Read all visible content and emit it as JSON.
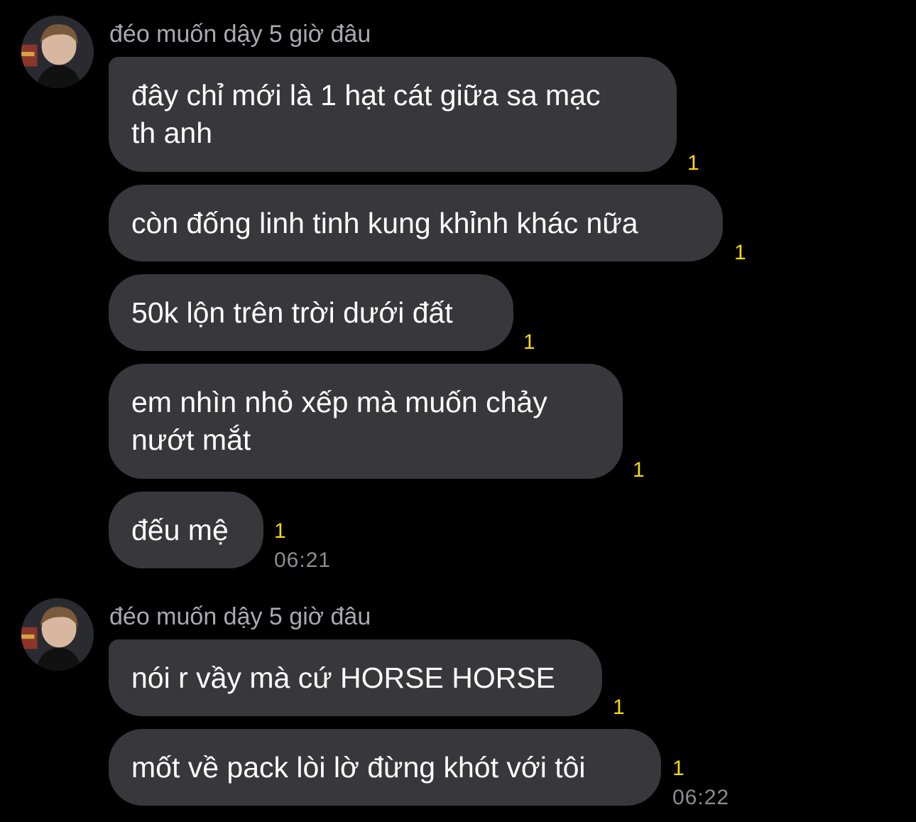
{
  "colors": {
    "background": "#000000",
    "bubble": "#38383c",
    "message_text": "#ffffff",
    "sender_name": "#a9a9ae",
    "read_count": "#f5d90a",
    "timestamp": "#8c8c91"
  },
  "groups": [
    {
      "sender": "đéo muốn dậy 5 giờ đâu",
      "avatar_icon": "user-avatar",
      "timestamp": "06:21",
      "messages": [
        {
          "text": "đây chỉ mới là 1 hạt cát giữa sa mạc\nth anh",
          "read_count": "1"
        },
        {
          "text": "còn đống linh tinh kung khỉnh khác nữa",
          "read_count": "1"
        },
        {
          "text": "50k lộn trên trời dưới đất",
          "read_count": "1"
        },
        {
          "text": "em nhìn nhỏ xếp mà muốn chảy\nnướt mắt",
          "read_count": "1"
        },
        {
          "text": "đếu mệ",
          "read_count": "1"
        }
      ]
    },
    {
      "sender": "đéo muốn dậy 5 giờ đâu",
      "avatar_icon": "user-avatar",
      "timestamp": "06:22",
      "messages": [
        {
          "text": "nói r vầy mà cứ HORSE HORSE",
          "read_count": "1"
        },
        {
          "text": "mốt về pack lòi lờ đừng khót với tôi",
          "read_count": "1"
        }
      ]
    }
  ]
}
